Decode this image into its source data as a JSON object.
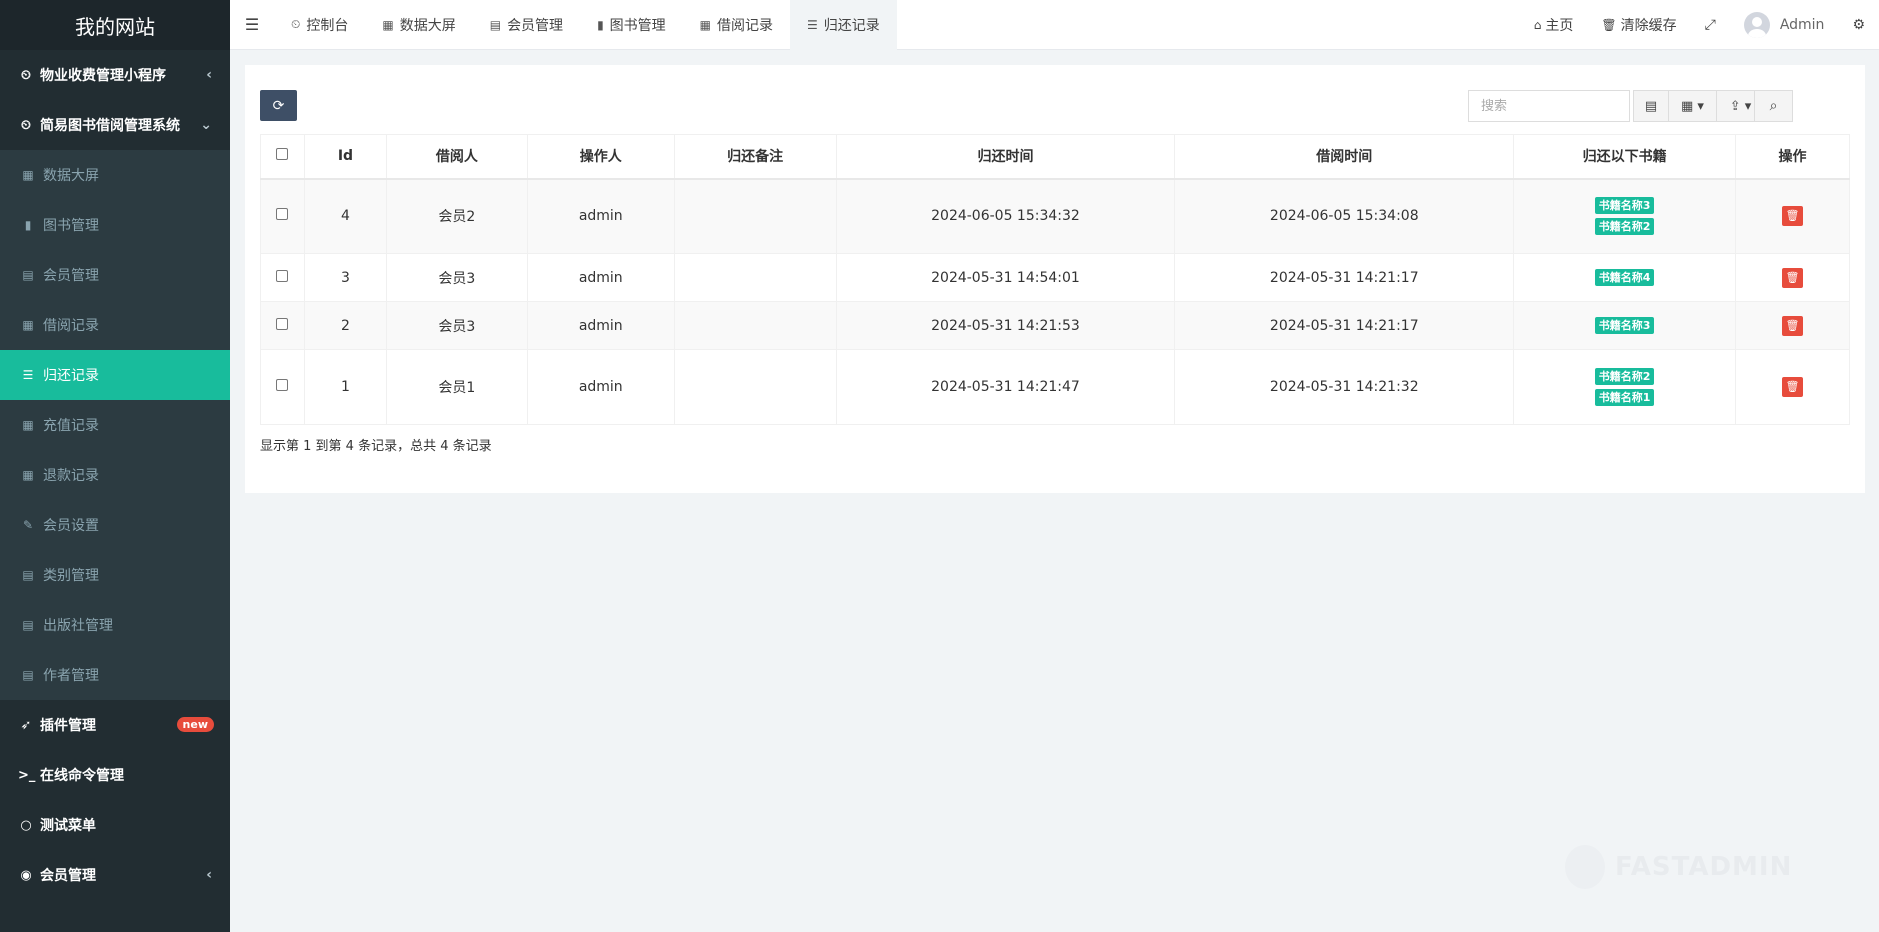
{
  "app": {
    "logo": "我的网站"
  },
  "sidebar": {
    "menu1": {
      "label": "物业收费管理小程序",
      "icon": "dashboard-icon",
      "arrow": "‹"
    },
    "menu2": {
      "label": "简易图书借阅管理系统",
      "icon": "dashboard-icon",
      "arrow": "⌄"
    },
    "items": [
      {
        "label": "数据大屏",
        "icon": "table-icon"
      },
      {
        "label": "图书管理",
        "icon": "book-icon"
      },
      {
        "label": "会员管理",
        "icon": "list-alt-icon"
      },
      {
        "label": "借阅记录",
        "icon": "table-icon"
      },
      {
        "label": "归还记录",
        "icon": "indent-icon"
      },
      {
        "label": "充值记录",
        "icon": "table-icon"
      },
      {
        "label": "退款记录",
        "icon": "table-icon"
      },
      {
        "label": "会员设置",
        "icon": "edit-icon"
      },
      {
        "label": "类别管理",
        "icon": "list-alt-icon"
      },
      {
        "label": "出版社管理",
        "icon": "list-alt-icon"
      },
      {
        "label": "作者管理",
        "icon": "list-alt-icon"
      }
    ],
    "plugin": {
      "label": "插件管理",
      "badge": "new",
      "icon": "rocket-icon"
    },
    "terminal": {
      "label": "在线命令管理",
      "icon": "terminal-icon"
    },
    "test": {
      "label": "测试菜单",
      "icon": "circle-icon"
    },
    "member": {
      "label": "会员管理",
      "icon": "user-circle-icon",
      "arrow": "‹"
    }
  },
  "topnav": {
    "tabs": [
      {
        "label": "控制台",
        "icon": "dashboard-icon"
      },
      {
        "label": "数据大屏",
        "icon": "table-icon"
      },
      {
        "label": "会员管理",
        "icon": "list-alt-icon"
      },
      {
        "label": "图书管理",
        "icon": "book-icon"
      },
      {
        "label": "借阅记录",
        "icon": "table-icon"
      },
      {
        "label": "归还记录",
        "icon": "indent-icon"
      }
    ],
    "home": "主页",
    "clear_cache": "清除缓存",
    "user": "Admin"
  },
  "toolbar": {
    "search_placeholder": "搜索"
  },
  "table": {
    "headers": [
      "Id",
      "借阅人",
      "操作人",
      "归还备注",
      "归还时间",
      "借阅时间",
      "归还以下书籍",
      "操作"
    ],
    "rows": [
      {
        "id": "4",
        "borrower": "会员2",
        "operator": "admin",
        "note": "",
        "return_time": "2024-06-05 15:34:32",
        "borrow_time": "2024-06-05 15:34:08",
        "books": [
          "书籍名称3",
          "书籍名称2"
        ]
      },
      {
        "id": "3",
        "borrower": "会员3",
        "operator": "admin",
        "note": "",
        "return_time": "2024-05-31 14:54:01",
        "borrow_time": "2024-05-31 14:21:17",
        "books": [
          "书籍名称4"
        ]
      },
      {
        "id": "2",
        "borrower": "会员3",
        "operator": "admin",
        "note": "",
        "return_time": "2024-05-31 14:21:53",
        "borrow_time": "2024-05-31 14:21:17",
        "books": [
          "书籍名称3"
        ]
      },
      {
        "id": "1",
        "borrower": "会员1",
        "operator": "admin",
        "note": "",
        "return_time": "2024-05-31 14:21:47",
        "borrow_time": "2024-05-31 14:21:32",
        "books": [
          "书籍名称2",
          "书籍名称1"
        ]
      }
    ]
  },
  "pagination": {
    "text": "显示第 1 到第 4 条记录，总共 4 条记录"
  },
  "watermark": "FASTADMIN",
  "colors": {
    "sidebar_bg": "#222d32",
    "accent": "#18bc9c",
    "danger": "#e74c3c",
    "button_dark": "#3e4f66"
  }
}
